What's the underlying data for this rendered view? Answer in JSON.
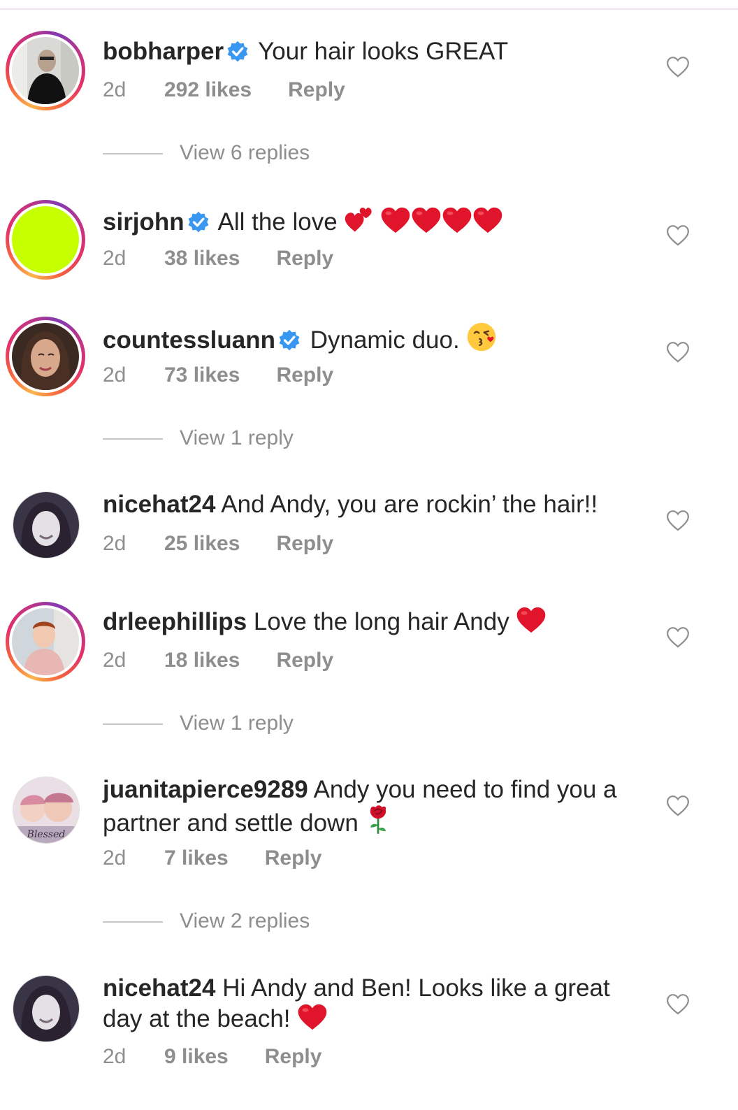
{
  "comments": [
    {
      "username": "bobharper",
      "verified": true,
      "text": "Your hair looks GREAT",
      "time": "2d",
      "likes": "292 likes",
      "reply": "Reply",
      "view_replies": "View 6 replies"
    },
    {
      "username": "sirjohn",
      "verified": true,
      "text": "All the love",
      "time": "2d",
      "likes": "38 likes",
      "reply": "Reply"
    },
    {
      "username": "countessluann",
      "verified": true,
      "text": "Dynamic duo.",
      "time": "2d",
      "likes": "73 likes",
      "reply": "Reply",
      "view_replies": "View 1 reply"
    },
    {
      "username": "nicehat24",
      "verified": false,
      "text": "And Andy, you are rockin’ the hair!!",
      "time": "2d",
      "likes": "25 likes",
      "reply": "Reply"
    },
    {
      "username": "drleephillips",
      "verified": false,
      "text": "Love the long hair Andy",
      "time": "2d",
      "likes": "18 likes",
      "reply": "Reply",
      "view_replies": "View 1 reply"
    },
    {
      "username": "juanitapierce9289",
      "verified": false,
      "text": "Andy you need to find you a partner and settle down",
      "time": "2d",
      "likes": "7 likes",
      "reply": "Reply",
      "view_replies": "View 2 replies",
      "avatar_text": "Blessed"
    },
    {
      "username": "nicehat24",
      "verified": false,
      "text": "Hi Andy and Ben! Looks like a great day at the beach!",
      "time": "2d",
      "likes": "9 likes",
      "reply": "Reply"
    }
  ],
  "colors": {
    "text": "#262626",
    "meta": "#8e8e8e",
    "verified_blue": "#3897f0",
    "heart_red": "#e0142a",
    "avatar_lime": "#c6ff00"
  },
  "icons": [
    "verified-badge-icon",
    "heart-outline-icon",
    "red-heart-emoji",
    "two-hearts-emoji",
    "kissing-face-emoji",
    "rose-emoji"
  ]
}
